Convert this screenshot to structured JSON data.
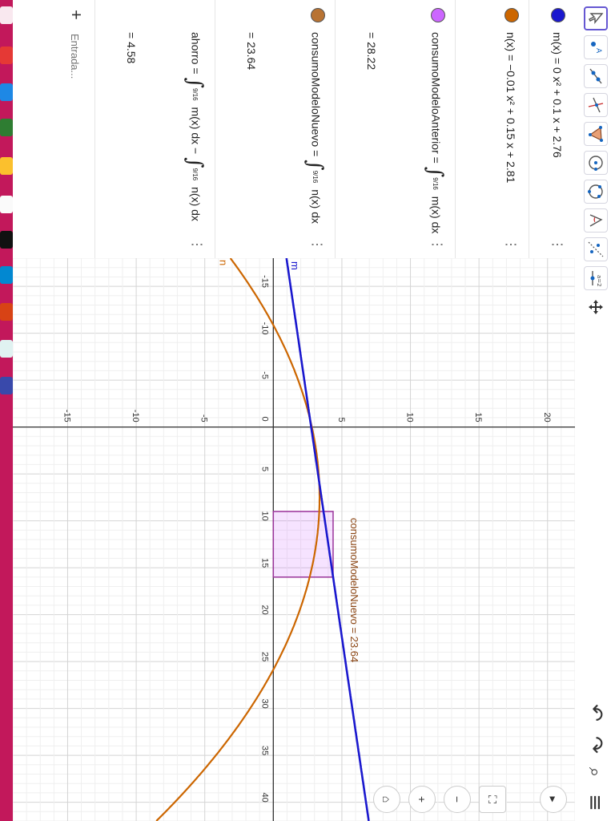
{
  "algebra": {
    "rows": [
      {
        "name": "m",
        "color": "#1a18ce",
        "expr": "m(x) = 0 x² + 0.1 x + 2.76",
        "value": ""
      },
      {
        "name": "n",
        "color": "#cc6600",
        "expr": "n(x) = −0.01 x² + 0.15 x + 2.81",
        "value": ""
      },
      {
        "name": "consumoModeloAnterior",
        "color": "#cc66ff",
        "label": "consumoModeloAnterior =",
        "integral_lower": "9",
        "integral_upper": "16",
        "integrand": "m(x) dx",
        "value": "= 28.22"
      },
      {
        "name": "consumoModeloNuevo",
        "color": "#b87333",
        "label": "consumoModeloNuevo =",
        "integral_lower": "9",
        "integral_upper": "16",
        "integrand": "n(x) dx",
        "value": "= 23.64"
      },
      {
        "name": "ahorro",
        "color": "",
        "label": "ahorro =",
        "integral_lower": "9",
        "integral_upper": "16",
        "integrand": "m(x) dx −",
        "integrand2": "n(x) dx",
        "value": "= 4.58"
      }
    ],
    "input_placeholder": "Entrada..."
  },
  "graph": {
    "x_ticks": [
      "-15",
      "-10",
      "-5",
      "0",
      "5",
      "10",
      "15",
      "20",
      "25",
      "30",
      "35",
      "40"
    ],
    "y_ticks": [
      "-15",
      "-10",
      "-5",
      "5",
      "10",
      "15",
      "20"
    ],
    "m_label": "m",
    "n_label": "n",
    "shaded_label": "consumoModeloNuevo = 23.64",
    "shade_from": 9,
    "shade_to": 16,
    "xlim": [
      -18,
      42
    ],
    "ylim": [
      -19,
      22
    ]
  },
  "colors": {
    "m": "#1a18ce",
    "n": "#cc6600",
    "shade": "#cc66ff",
    "accent": "#6557d2",
    "taskbar": "#c2185b"
  }
}
